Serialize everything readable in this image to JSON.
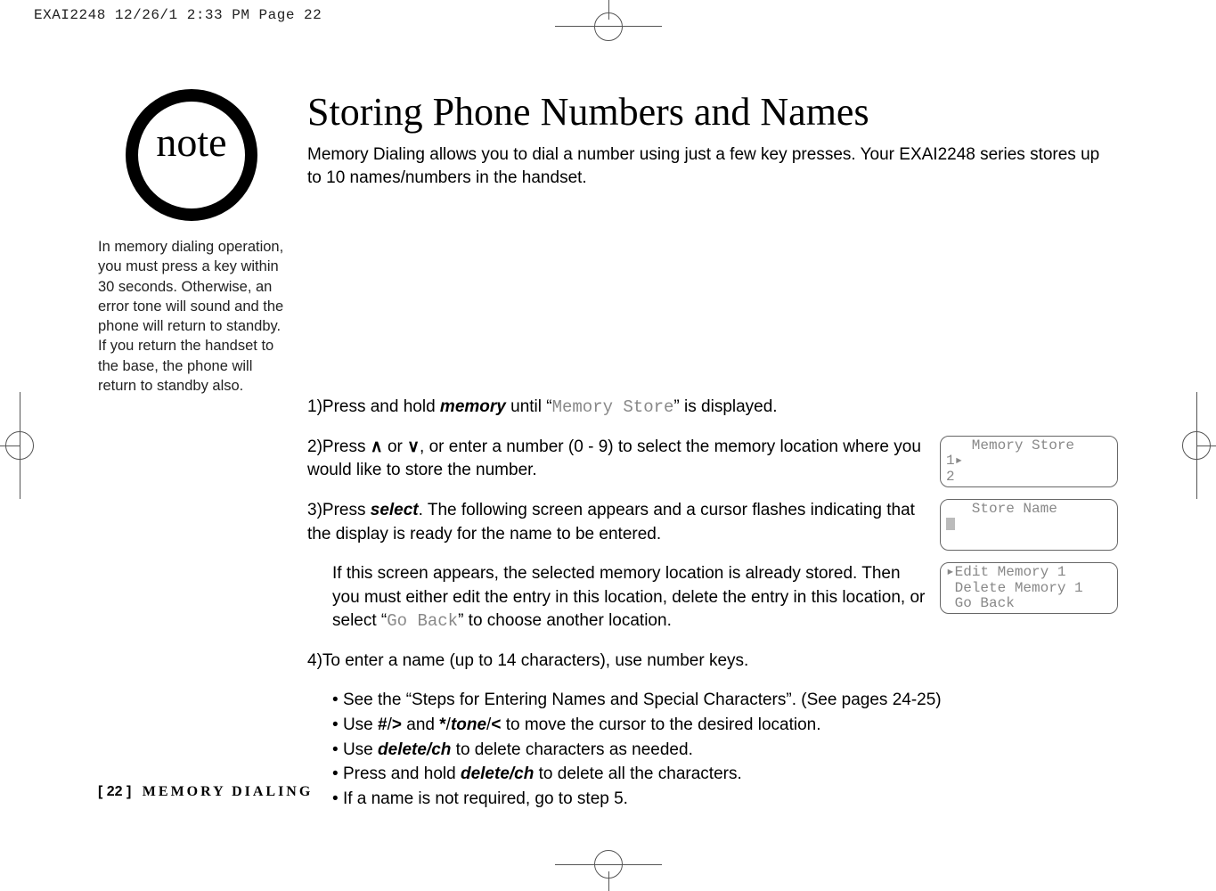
{
  "slug": "EXAI2248  12/26/1 2:33 PM  Page 22",
  "note_icon_label": "note",
  "note_text": "In memory dialing operation, you must press a key within 30 seconds. Otherwise, an error tone will sound and the phone will return to standby. If you return the handset to the base, the phone will return to standby also.",
  "title": "Storing Phone Numbers and Names",
  "intro": "Memory Dialing allows you to dial a number using just a few key presses. Your EXAI2248 series stores up to 10 names/numbers in the handset.",
  "steps": {
    "s1_pre": "1)Press and hold ",
    "s1_key": "memory",
    "s1_mid": " until “",
    "s1_mono": "Memory Store",
    "s1_post": "” is displayed.",
    "s2_pre": "2)Press ",
    "s2_up": "∧",
    "s2_mid1": " or ",
    "s2_down": "∨",
    "s2_post": ", or enter a number (0 - 9) to select the memory location where you would like to store the number.",
    "s3_pre": "3)Press ",
    "s3_key": "select",
    "s3_post": ". The following screen appears and a cursor flashes indicating that the display is ready for the name to be entered.",
    "s3b_pre": "If this screen appears, the selected memory location is already stored. Then you must either edit the entry in this location, delete the entry in this location, or select “",
    "s3b_mono": "Go Back",
    "s3b_post": "” to choose another location.",
    "s4": "4)To enter a name (up to 14 characters), use number keys."
  },
  "lcd": {
    "l1": "   Memory Store\n1▸\n2",
    "l2_title": "   Store Name",
    "l3": "▸Edit Memory 1\n Delete Memory 1\n Go Back"
  },
  "bullets": {
    "b1": "See the “Steps for Entering Names and Special Characters”. (See pages 24-25)",
    "b2_pre": "Use ",
    "b2_k1": "#",
    "b2_slash1": "/",
    "b2_gt": ">",
    "b2_and": " and ",
    "b2_k2": "*",
    "b2_slash2": "/",
    "b2_tone": "tone",
    "b2_slash3": "/",
    "b2_lt": "<",
    "b2_post": " to move the cursor to the desired location.",
    "b3_pre": "Use ",
    "b3_key": "delete/ch",
    "b3_post": " to delete characters as needed.",
    "b4_pre": "Press and hold ",
    "b4_key": "delete/ch",
    "b4_post": " to delete all the characters.",
    "b5": "If a name is not required, go to step 5."
  },
  "footer": {
    "pagenum": "[ 22 ]",
    "section": "MEMORY DIALING"
  }
}
